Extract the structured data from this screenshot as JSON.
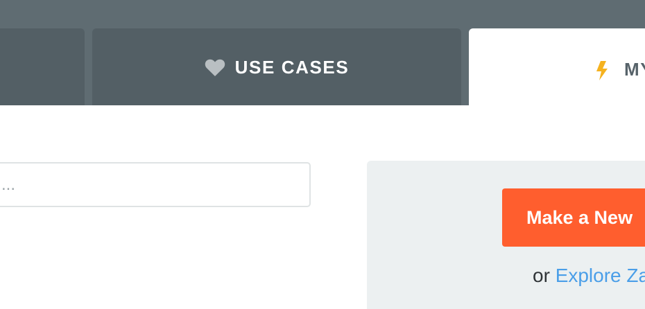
{
  "tabs": {
    "use_cases": {
      "label": "USE CASES",
      "icon": "heart-icon"
    },
    "my": {
      "label": "MY",
      "icon": "bolt-icon"
    }
  },
  "search": {
    "placeholder": "..."
  },
  "panel": {
    "make_button_label": "Make a New",
    "or_text": "or",
    "explore_link": "Explore Za"
  },
  "colors": {
    "top_bar": "#5f6c72",
    "tab_bg": "#535f65",
    "tab_active_bg": "#ffffff",
    "heart_icon": "#b9bfc2",
    "bolt_icon": "#f5b21f",
    "button_bg": "#ff5e2e",
    "link": "#4a9ee8",
    "panel_bg": "#ecf0f1"
  }
}
